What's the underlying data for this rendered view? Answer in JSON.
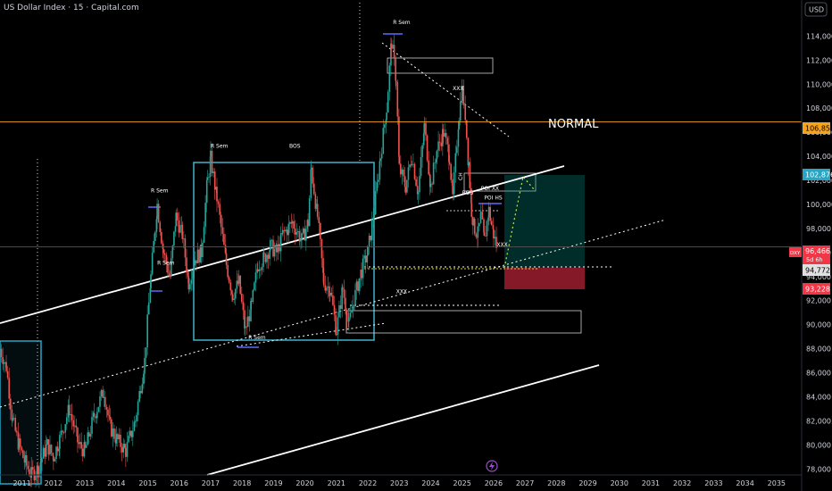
{
  "header": {
    "title": "US Dollar Index · 15 · Capital.com",
    "currency_button": "USD"
  },
  "annotations": {
    "normal": "NORMAL",
    "ch": "CH"
  },
  "price_badges": {
    "orange": {
      "value": "106,859",
      "color": "#f7a21b"
    },
    "cyan": {
      "value": "102,876",
      "color": "#26a6c4"
    },
    "red_symbol": "DXY",
    "red_price": "96,466",
    "red_timer": "5d 6h",
    "red_color": "#f23645",
    "gray": {
      "value": "94,772",
      "color": "#e0e0e0"
    },
    "red2": {
      "value": "93,228",
      "color": "#f23645"
    }
  },
  "chart_data": {
    "type": "candlestick",
    "title": "US Dollar Index · 15 · Capital.com",
    "y_ticks": [
      78000,
      80000,
      82000,
      84000,
      86000,
      88000,
      90000,
      92000,
      94000,
      96000,
      98000,
      100000,
      102000,
      104000,
      106000,
      108000,
      110000,
      112000,
      114000,
      116000
    ],
    "y_tick_labels": [
      "78,000",
      "80,000",
      "82,000",
      "84,000",
      "86,000",
      "88,000",
      "90,000",
      "92,000",
      "94,000",
      "96,000",
      "98,000",
      "100,000",
      "102,000",
      "104,000",
      "106,000",
      "108,000",
      "110,000",
      "112,000",
      "114,000",
      "116,000"
    ],
    "ylim": [
      77500,
      117000
    ],
    "x_ticks": [
      "2011",
      "2012",
      "2013",
      "2014",
      "2015",
      "2016",
      "2017",
      "2018",
      "2019",
      "2020",
      "2021",
      "2022",
      "2023",
      "2024",
      "2025",
      "2026",
      "2027",
      "2028",
      "2029",
      "2030",
      "2031",
      "2032",
      "2033",
      "2034",
      "2035"
    ],
    "xlim": [
      2010.3,
      2035.8
    ],
    "series": [
      {
        "name": "DXY",
        "points": [
          [
            2010.3,
            88000
          ],
          [
            2010.5,
            86500
          ],
          [
            2010.7,
            82000
          ],
          [
            2010.9,
            80000
          ],
          [
            2011.1,
            78500
          ],
          [
            2011.3,
            77500
          ],
          [
            2011.5,
            78000
          ],
          [
            2011.8,
            80000
          ],
          [
            2012.0,
            79000
          ],
          [
            2012.2,
            80500
          ],
          [
            2012.5,
            83000
          ],
          [
            2012.8,
            80000
          ],
          [
            2013.0,
            79500
          ],
          [
            2013.3,
            82500
          ],
          [
            2013.6,
            84500
          ],
          [
            2013.8,
            81500
          ],
          [
            2014.0,
            80500
          ],
          [
            2014.3,
            79500
          ],
          [
            2014.6,
            82000
          ],
          [
            2014.9,
            87000
          ],
          [
            2015.1,
            94000
          ],
          [
            2015.3,
            100000
          ],
          [
            2015.5,
            96000
          ],
          [
            2015.7,
            94000
          ],
          [
            2015.9,
            99000
          ],
          [
            2016.1,
            97500
          ],
          [
            2016.3,
            93500
          ],
          [
            2016.5,
            95500
          ],
          [
            2016.7,
            96000
          ],
          [
            2016.9,
            102000
          ],
          [
            2017.0,
            103800
          ],
          [
            2017.2,
            100500
          ],
          [
            2017.5,
            95000
          ],
          [
            2017.7,
            92500
          ],
          [
            2017.9,
            93500
          ],
          [
            2018.1,
            89500
          ],
          [
            2018.3,
            91500
          ],
          [
            2018.5,
            95000
          ],
          [
            2018.7,
            95500
          ],
          [
            2018.9,
            96500
          ],
          [
            2019.1,
            96000
          ],
          [
            2019.3,
            97500
          ],
          [
            2019.6,
            98500
          ],
          [
            2019.9,
            97000
          ],
          [
            2020.1,
            98500
          ],
          [
            2020.2,
            103000
          ],
          [
            2020.4,
            99000
          ],
          [
            2020.6,
            93500
          ],
          [
            2020.8,
            93000
          ],
          [
            2021.0,
            89500
          ],
          [
            2021.2,
            93000
          ],
          [
            2021.4,
            90000
          ],
          [
            2021.6,
            92500
          ],
          [
            2021.8,
            94500
          ],
          [
            2022.0,
            96000
          ],
          [
            2022.2,
            99500
          ],
          [
            2022.4,
            104000
          ],
          [
            2022.6,
            108000
          ],
          [
            2022.75,
            113500
          ],
          [
            2022.9,
            110500
          ],
          [
            2023.0,
            103000
          ],
          [
            2023.2,
            101500
          ],
          [
            2023.4,
            104000
          ],
          [
            2023.6,
            101000
          ],
          [
            2023.8,
            106500
          ],
          [
            2024.0,
            101500
          ],
          [
            2024.2,
            104500
          ],
          [
            2024.4,
            106000
          ],
          [
            2024.6,
            104000
          ],
          [
            2024.7,
            100500
          ],
          [
            2024.9,
            107500
          ],
          [
            2025.0,
            109500
          ],
          [
            2025.1,
            107500
          ],
          [
            2025.2,
            103500
          ],
          [
            2025.3,
            99500
          ],
          [
            2025.4,
            98000
          ],
          [
            2025.5,
            97500
          ],
          [
            2025.6,
            99000
          ],
          [
            2025.7,
            97000
          ],
          [
            2025.85,
            99500
          ],
          [
            2026.0,
            97500
          ],
          [
            2026.1,
            96466
          ]
        ]
      }
    ],
    "price_lines": [
      {
        "name": "orange-line",
        "y": 106859,
        "color": "#f7a21b"
      },
      {
        "name": "gray-line",
        "y": 96466,
        "color": "#555555"
      }
    ],
    "labels": [
      {
        "text": "R Sem",
        "x": 2022.8,
        "y": 115000
      },
      {
        "text": "R Sem",
        "x": 2017.0,
        "y": 104700
      },
      {
        "text": "R Sem",
        "x": 2015.1,
        "y": 101000
      },
      {
        "text": "R Sem",
        "x": 2015.3,
        "y": 95000
      },
      {
        "text": "R Sem",
        "x": 2018.2,
        "y": 88800
      },
      {
        "text": "BOS",
        "x": 2019.5,
        "y": 104700
      },
      {
        "text": "BOS",
        "x": 2025.0,
        "y": 100800
      },
      {
        "text": "POI XX",
        "x": 2025.6,
        "y": 101200
      },
      {
        "text": "POI HS",
        "x": 2025.7,
        "y": 100400
      },
      {
        "text": "XXX",
        "x": 2024.7,
        "y": 109500
      },
      {
        "text": "XXX",
        "x": 2026.1,
        "y": 96500
      },
      {
        "text": "XXX",
        "x": 2022.9,
        "y": 92600
      }
    ]
  }
}
